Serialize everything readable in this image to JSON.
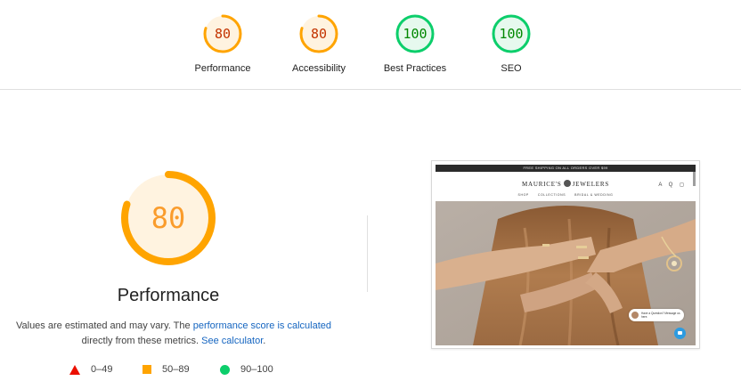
{
  "categories": [
    {
      "label": "Performance",
      "score": "80",
      "value": 80,
      "color": "#ffa400",
      "fill": "#fff3e0",
      "text_class": "orange-txt"
    },
    {
      "label": "Accessibility",
      "score": "80",
      "value": 80,
      "color": "#ffa400",
      "fill": "#fff3e0",
      "text_class": "orange-txt"
    },
    {
      "label": "Best Practices",
      "score": "100",
      "value": 100,
      "color": "#0cce6b",
      "fill": "#e6f9ee",
      "text_class": "green-txt"
    },
    {
      "label": "SEO",
      "score": "100",
      "value": 100,
      "color": "#0cce6b",
      "fill": "#e6f9ee",
      "text_class": "green-txt"
    }
  ],
  "main_gauge": {
    "score": "80",
    "value": 80,
    "title": "Performance",
    "color": "#ffa400",
    "fill": "#fff3e0"
  },
  "description": {
    "text_before": "Values are estimated and may vary. The ",
    "link1": "performance score is calculated",
    "text_middle": " directly from these metrics. ",
    "link2": "See calculator",
    "text_after": "."
  },
  "legend": [
    {
      "range": "0–49",
      "shape": "triangle-icon",
      "color": "#eb0f00"
    },
    {
      "range": "50–89",
      "shape": "square-icon",
      "color": "#ffa400"
    },
    {
      "range": "90–100",
      "shape": "circle-icon",
      "color": "#0cce6b"
    }
  ],
  "screenshot": {
    "announcement": "FREE SHIPPING ON ALL ORDERS OVER $99",
    "logo_left": "MAURICE'S",
    "logo_right": "JEWELERS",
    "nav": [
      "SHOP",
      "COLLECTIONS",
      "BRIDAL & WEDDING"
    ],
    "header_icons": "A Q ◻",
    "chat_text": "Have a Question? Message us here."
  }
}
